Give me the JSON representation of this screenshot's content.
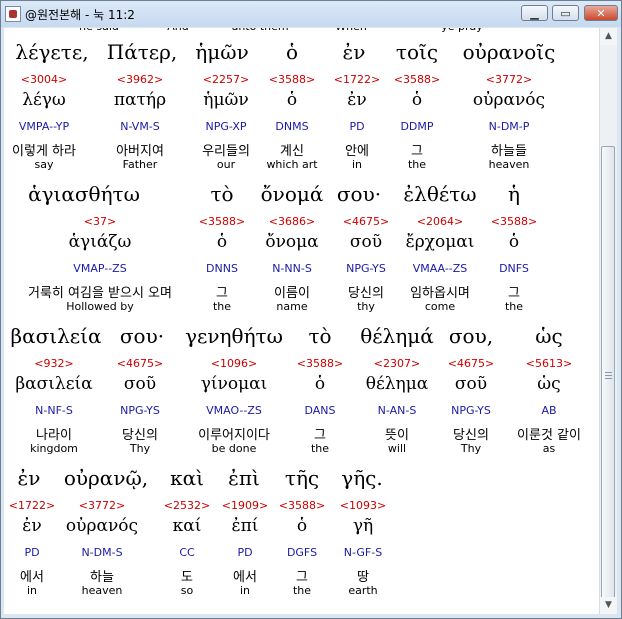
{
  "window": {
    "title": "@원전본해 - 눅 11:2",
    "buttons": {
      "minimize": "▁",
      "maximize": "▭",
      "close": "✕"
    }
  },
  "header_partial": [
    "he said",
    "And",
    "unto them",
    "When",
    "ye pray"
  ],
  "lines": [
    {
      "greek": [
        "λέγετε,",
        "Πάτερ,",
        "ἡμῶν",
        "ὁ",
        "ἐν",
        "τοῖς",
        "οὐρανοῖς"
      ],
      "words": [
        {
          "strongs": "<3004>",
          "lemma": "λέγω",
          "parse": "VMPA--YP",
          "korean": "이렇게 하라",
          "english": "say"
        },
        {
          "strongs": "<3962>",
          "lemma": "πατήρ",
          "parse": "N-VM-S",
          "korean": "아버지여",
          "english": "Father"
        },
        {
          "strongs": "<2257>",
          "lemma": "ἡμῶν",
          "parse": "NPG-XP",
          "korean": "우리들의",
          "english": "our"
        },
        {
          "strongs": "<3588>",
          "lemma": "ὁ",
          "parse": "DNMS",
          "korean": "계신",
          "english": "which art"
        },
        {
          "strongs": "<1722>",
          "lemma": "ἐν",
          "parse": "PD",
          "korean": "안에",
          "english": "in"
        },
        {
          "strongs": "<3588>",
          "lemma": "ὁ",
          "parse": "DDMP",
          "korean": "그",
          "english": "the"
        },
        {
          "strongs": "<3772>",
          "lemma": "οὐρανός",
          "parse": "N-DM-P",
          "korean": "하늘들",
          "english": "heaven"
        }
      ]
    },
    {
      "greek": [
        "ἁγιασθήτω",
        "τὸ",
        "ὄνομά",
        "σου·",
        "ἐλθέτω",
        "ἡ"
      ],
      "words": [
        {
          "strongs": "<37>",
          "lemma": "ἁγιάζω",
          "parse": "VMAP--ZS",
          "korean": "거룩히 여김을 받으시 오며",
          "english": "Hollowed by"
        },
        {
          "strongs": "<3588>",
          "lemma": "ὁ",
          "parse": "DNNS",
          "korean": "그",
          "english": "the"
        },
        {
          "strongs": "<3686>",
          "lemma": "ὄνομα",
          "parse": "N-NN-S",
          "korean": "이름이",
          "english": "name"
        },
        {
          "strongs": "<4675>",
          "lemma": "σοῦ",
          "parse": "NPG-YS",
          "korean": "당신의",
          "english": "thy"
        },
        {
          "strongs": "<2064>",
          "lemma": "ἔρχομαι",
          "parse": "VMAA--ZS",
          "korean": "임하옵시며",
          "english": "come"
        },
        {
          "strongs": "<3588>",
          "lemma": "ὁ",
          "parse": "DNFS",
          "korean": "그",
          "english": "the"
        }
      ]
    },
    {
      "greek": [
        "βασιλεία",
        "σου·",
        "γενηθήτω",
        "τὸ",
        "θέλημά",
        "σου,",
        "ὡς"
      ],
      "words": [
        {
          "strongs": "<932>",
          "lemma": "βασιλεία",
          "parse": "N-NF-S",
          "korean": "나라이",
          "english": "kingdom"
        },
        {
          "strongs": "<4675>",
          "lemma": "σοῦ",
          "parse": "NPG-YS",
          "korean": "당신의",
          "english": "Thy"
        },
        {
          "strongs": "<1096>",
          "lemma": "γίνομαι",
          "parse": "VMAO--ZS",
          "korean": "이루어지이다",
          "english": "be done"
        },
        {
          "strongs": "<3588>",
          "lemma": "ὁ",
          "parse": "DANS",
          "korean": "그",
          "english": "the"
        },
        {
          "strongs": "<2307>",
          "lemma": "θέλημα",
          "parse": "N-AN-S",
          "korean": "뜻이",
          "english": "will"
        },
        {
          "strongs": "<4675>",
          "lemma": "σοῦ",
          "parse": "NPG-YS",
          "korean": "당신의",
          "english": "Thy"
        },
        {
          "strongs": "<5613>",
          "lemma": "ὡς",
          "parse": "AB",
          "korean": "이룬것 같이",
          "english": "as"
        }
      ]
    },
    {
      "greek": [
        "ἐν",
        "οὐρανῷ,",
        "καὶ",
        "ἐπὶ",
        "τῆς",
        "γῆς."
      ],
      "words": [
        {
          "strongs": "<1722>",
          "lemma": "ἐν",
          "parse": "PD",
          "korean": "에서",
          "english": "in"
        },
        {
          "strongs": "<3772>",
          "lemma": "οὐρανός",
          "parse": "N-DM-S",
          "korean": "하늘",
          "english": "heaven"
        },
        {
          "strongs": "<2532>",
          "lemma": "καί",
          "parse": "CC",
          "korean": "도",
          "english": "so"
        },
        {
          "strongs": "<1909>",
          "lemma": "ἐπί",
          "parse": "PD",
          "korean": "에서",
          "english": "in"
        },
        {
          "strongs": "<3588>",
          "lemma": "ὁ",
          "parse": "DGFS",
          "korean": "그",
          "english": "the"
        },
        {
          "strongs": "<1093>",
          "lemma": "γῆ",
          "parse": "N-GF-S",
          "korean": "땅",
          "english": "earth"
        }
      ]
    }
  ]
}
